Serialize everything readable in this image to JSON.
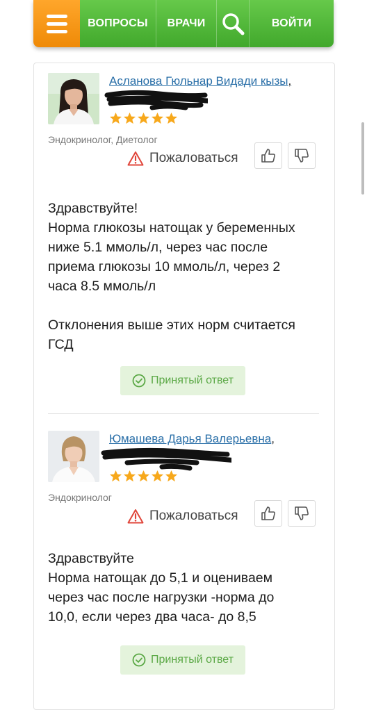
{
  "nav": {
    "questions": "ВОПРОСЫ",
    "doctors": "ВРАЧИ",
    "login": "ВОЙТИ"
  },
  "answers": [
    {
      "doctor_name": "Асланова Гюльнар Видади кызы",
      "comma": ",",
      "specialty": "Эндокринолог, Диетолог",
      "complain": "Пожаловаться",
      "rating": 5,
      "paragraphs": [
        "Здравствуйте!",
        "Норма глюкозы натощак у беременных",
        "ниже 5.1 ммоль/л, через час после",
        "приема глюкозы 10 ммоль/л, через 2",
        "часа 8.5 ммоль/л",
        "Отклонения выше этих норм считается",
        "ГСД"
      ],
      "accepted": "Принятый ответ"
    },
    {
      "doctor_name": "Юмашева Дарья Валерьевна",
      "comma": ",",
      "specialty": "Эндокринолог",
      "complain": "Пожаловаться",
      "rating": 5,
      "paragraphs": [
        "Здравствуйте",
        "Норма натощак до 5,1 и оцениваем",
        "через час после нагрузки -норма до",
        "10,0, если через два часа- до 8,5"
      ],
      "accepted": "Принятый ответ"
    }
  ],
  "colors": {
    "nav_green": "#4fb835",
    "nav_orange": "#f5941a",
    "link_blue": "#2a6fa8",
    "star_orange": "#f7a81b",
    "accepted_bg": "#e4f3dc",
    "accepted_text": "#5aa845",
    "warning_red": "#e0453a"
  },
  "icons": {
    "menu": "hamburger-menu-icon",
    "search": "search-icon",
    "warning": "warning-triangle-icon",
    "like": "thumbs-up-icon",
    "dislike": "thumbs-down-icon",
    "accepted": "check-circle-icon",
    "star": "star-icon"
  }
}
